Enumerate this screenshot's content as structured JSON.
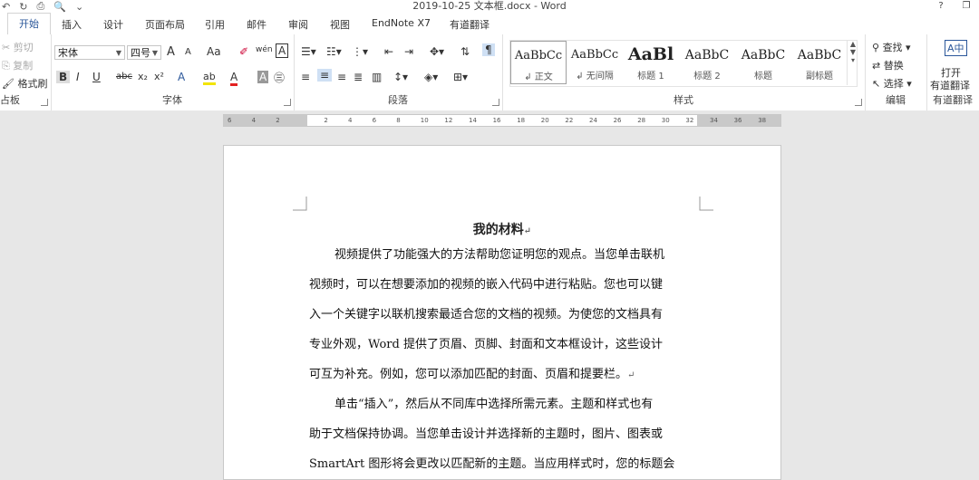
{
  "window": {
    "title": "2019-10-25 文本框.docx - Word",
    "help": "?",
    "restore": "❐"
  },
  "qat": {
    "undo": "↶",
    "redo": "↻",
    "print": "⎙",
    "preview": "🔍",
    "more": "⌄"
  },
  "tabs": [
    "开始",
    "插入",
    "设计",
    "页面布局",
    "引用",
    "邮件",
    "审阅",
    "视图",
    "EndNote X7",
    "有道翻译"
  ],
  "clipboard": {
    "cut": "剪切",
    "copy": "复制",
    "format_painter": "格式刷",
    "label": "占板"
  },
  "font": {
    "name": "宋体",
    "size": "四号",
    "grow": "A",
    "shrink": "A",
    "case": "Aa",
    "clear": "✐",
    "phonetic": "wén",
    "border": "A",
    "bold": "B",
    "italic": "I",
    "underline": "U",
    "strike": "abc",
    "sub": "x₂",
    "sup": "x²",
    "effects": "A",
    "highlight": "ab",
    "color": "A",
    "shade": "A",
    "enclose": "㊂",
    "label": "字体",
    "colors": {
      "highlight": "#f2e400",
      "font": "#e32222"
    }
  },
  "paragraph": {
    "label": "段落"
  },
  "styles": {
    "label": "样式",
    "items": [
      {
        "sample": "AaBbCc",
        "name": "↲ 正文"
      },
      {
        "sample": "AaBbCc",
        "name": "↲ 无间隔"
      },
      {
        "sample": "AaBl",
        "name": "标题 1"
      },
      {
        "sample": "AaBbC",
        "name": "标题 2"
      },
      {
        "sample": "AaBbC",
        "name": "标题"
      },
      {
        "sample": "AaBbC",
        "name": "副标题"
      }
    ]
  },
  "editing": {
    "find": "查找",
    "replace": "替换",
    "select": "选择",
    "label": "编辑"
  },
  "youdao": {
    "open": "打开",
    "translate": "有道翻译",
    "label": "有道翻译"
  },
  "ruler": {
    "numbers": [
      "6",
      "4",
      "2",
      "",
      "2",
      "4",
      "6",
      "8",
      "10",
      "12",
      "14",
      "16",
      "18",
      "20",
      "22",
      "24",
      "26",
      "28",
      "30",
      "32",
      "34",
      "36",
      "38"
    ]
  },
  "document": {
    "title": "我的材料",
    "para1": [
      "视频提供了功能强大的方法帮助您证明您的观点。当您单击联机",
      "视频时，可以在想要添加的视频的嵌入代码中进行粘贴。您也可以键",
      "入一个关键字以联机搜索最适合您的文档的视频。为使您的文档具有",
      "专业外观，Word 提供了页眉、页脚、封面和文本框设计，这些设计",
      "可互为补充。例如，您可以添加匹配的封面、页眉和提要栏。"
    ],
    "para2": [
      "单击“插入”，然后从不同库中选择所需元素。主题和样式也有",
      "助于文档保持协调。当您单击设计并选择新的主题时，图片、图表或",
      "SmartArt 图形将会更改以匹配新的主题。当应用样式时，您的标题会"
    ],
    "pilcrow": "↵"
  }
}
